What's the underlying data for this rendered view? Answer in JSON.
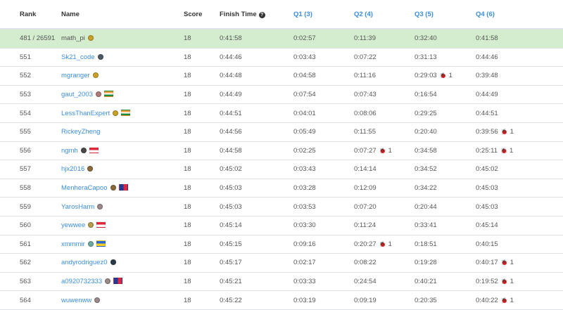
{
  "header": {
    "rank": "Rank",
    "name": "Name",
    "score": "Score",
    "finish_time": "Finish Time",
    "q1": "Q1 (3)",
    "q2": "Q2 (4)",
    "q3": "Q3 (5)",
    "q4": "Q4 (6)"
  },
  "rows": [
    {
      "rank": "481 / 26591",
      "name": "math_pi",
      "score": "18",
      "finish": "0:41:58",
      "q1": "0:02:57",
      "q2": "0:11:39",
      "q3": "0:32:40",
      "q4": "0:41:58",
      "badge": "#c9a227",
      "flag": "",
      "highlight": true,
      "q2_bug": "",
      "q3_bug": "",
      "q4_bug": ""
    },
    {
      "rank": "551",
      "name": "Sk21_code",
      "score": "18",
      "finish": "0:44:46",
      "q1": "0:03:43",
      "q2": "0:07:22",
      "q3": "0:31:13",
      "q4": "0:44:46",
      "badge": "#4a5a63",
      "flag": "",
      "q2_bug": "",
      "q3_bug": "",
      "q4_bug": ""
    },
    {
      "rank": "552",
      "name": "mgranger",
      "score": "18",
      "finish": "0:44:48",
      "q1": "0:04:58",
      "q2": "0:11:16",
      "q3": "0:29:03",
      "q4": "0:39:48",
      "badge": "#c9a227",
      "flag": "",
      "q2_bug": "",
      "q3_bug": "1",
      "q4_bug": ""
    },
    {
      "rank": "553",
      "name": "gaut_2003",
      "score": "18",
      "finish": "0:44:49",
      "q1": "0:07:54",
      "q2": "0:07:43",
      "q3": "0:16:54",
      "q4": "0:44:49",
      "badge": "#b07a7a",
      "flag": "india",
      "q2_bug": "",
      "q3_bug": "",
      "q4_bug": ""
    },
    {
      "rank": "554",
      "name": "LessThanExpert",
      "score": "18",
      "finish": "0:44:51",
      "q1": "0:04:01",
      "q2": "0:08:06",
      "q3": "0:29:25",
      "q4": "0:44:51",
      "badge": "#c9a227",
      "flag": "india",
      "q2_bug": "",
      "q3_bug": "",
      "q4_bug": ""
    },
    {
      "rank": "555",
      "name": "RickeyZheng",
      "score": "18",
      "finish": "0:44:56",
      "q1": "0:05:49",
      "q2": "0:11:55",
      "q3": "0:20:40",
      "q4": "0:39:56",
      "badge": "",
      "flag": "",
      "q2_bug": "",
      "q3_bug": "",
      "q4_bug": "1"
    },
    {
      "rank": "556",
      "name": "ngmh",
      "score": "18",
      "finish": "0:44:58",
      "q1": "0:02:25",
      "q2": "0:07:27",
      "q3": "0:34:58",
      "q4": "0:25:11",
      "badge": "#4a4a4a",
      "flag": "singapore",
      "q2_bug": "1",
      "q3_bug": "",
      "q4_bug": "1"
    },
    {
      "rank": "557",
      "name": "hjx2016",
      "score": "18",
      "finish": "0:45:02",
      "q1": "0:03:43",
      "q2": "0:14:14",
      "q3": "0:34:52",
      "q4": "0:45:02",
      "badge": "#8a6a3a",
      "flag": "",
      "q2_bug": "",
      "q3_bug": "",
      "q4_bug": ""
    },
    {
      "rank": "558",
      "name": "MenheraCapoo",
      "score": "18",
      "finish": "0:45:03",
      "q1": "0:03:28",
      "q2": "0:12:09",
      "q3": "0:34:22",
      "q4": "0:45:03",
      "badge": "#8a6a3a",
      "flag": "taiwan",
      "q2_bug": "",
      "q3_bug": "",
      "q4_bug": ""
    },
    {
      "rank": "559",
      "name": "YarosHarm",
      "score": "18",
      "finish": "0:45:03",
      "q1": "0:03:53",
      "q2": "0:07:20",
      "q3": "0:20:44",
      "q4": "0:45:03",
      "badge": "#9a8a8a",
      "flag": "",
      "q2_bug": "",
      "q3_bug": "",
      "q4_bug": ""
    },
    {
      "rank": "560",
      "name": "yewwee",
      "score": "18",
      "finish": "0:45:14",
      "q1": "0:03:30",
      "q2": "0:11:24",
      "q3": "0:33:41",
      "q4": "0:45:14",
      "badge": "#b89a4a",
      "flag": "singapore",
      "q2_bug": "",
      "q3_bug": "",
      "q4_bug": ""
    },
    {
      "rank": "561",
      "name": "xmmmir",
      "score": "18",
      "finish": "0:45:15",
      "q1": "0:09:16",
      "q2": "0:20:27",
      "q3": "0:18:51",
      "q4": "0:40:15",
      "badge": "#6aaaa0",
      "flag": "ukraine",
      "q2_bug": "1",
      "q3_bug": "",
      "q4_bug": ""
    },
    {
      "rank": "562",
      "name": "andyrodriguez0",
      "score": "18",
      "finish": "0:45:17",
      "q1": "0:02:17",
      "q2": "0:08:22",
      "q3": "0:19:28",
      "q4": "0:40:17",
      "badge": "#2a3a4a",
      "flag": "",
      "q2_bug": "",
      "q3_bug": "",
      "q4_bug": "1"
    },
    {
      "rank": "563",
      "name": "a0920732333",
      "score": "18",
      "finish": "0:45:21",
      "q1": "0:03:33",
      "q2": "0:24:54",
      "q3": "0:40:21",
      "q4": "0:19:52",
      "badge": "#9a8a8a",
      "flag": "taiwan",
      "q2_bug": "",
      "q3_bug": "",
      "q4_bug": "1"
    },
    {
      "rank": "564",
      "name": "wuwenww",
      "score": "18",
      "finish": "0:45:22",
      "q1": "0:03:19",
      "q2": "0:09:19",
      "q3": "0:20:35",
      "q4": "0:40:22",
      "badge": "#9a8a8a",
      "flag": "",
      "q2_bug": "",
      "q3_bug": "",
      "q4_bug": "1"
    }
  ],
  "colors": {
    "highlight_row": "#d4edcf",
    "link": "#3b8edb",
    "bug": "#d0342c"
  },
  "icons": {
    "finish_time_help": "question-circle-icon",
    "wrong_attempt": "bug-icon"
  }
}
